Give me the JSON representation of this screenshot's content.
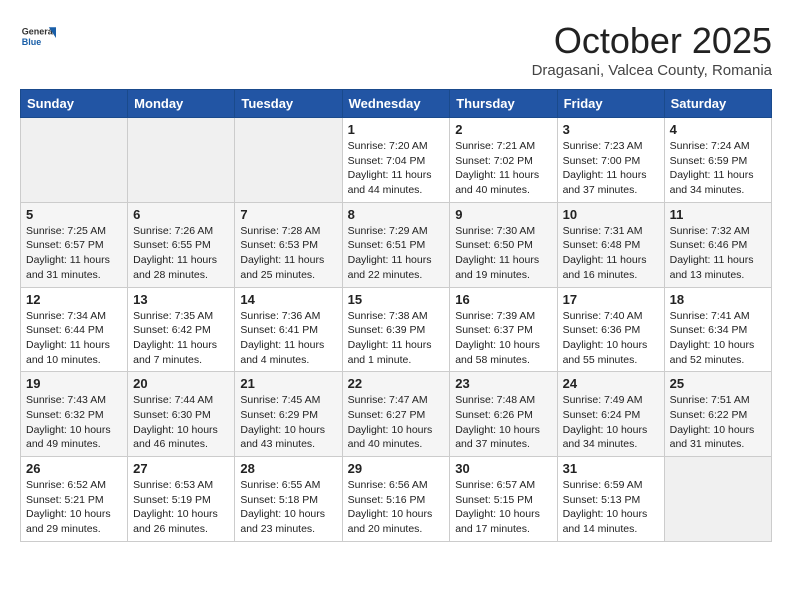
{
  "header": {
    "logo_general": "General",
    "logo_blue": "Blue",
    "month": "October 2025",
    "location": "Dragasani, Valcea County, Romania"
  },
  "weekdays": [
    "Sunday",
    "Monday",
    "Tuesday",
    "Wednesday",
    "Thursday",
    "Friday",
    "Saturday"
  ],
  "weeks": [
    [
      {
        "day": "",
        "info": ""
      },
      {
        "day": "",
        "info": ""
      },
      {
        "day": "",
        "info": ""
      },
      {
        "day": "1",
        "info": "Sunrise: 7:20 AM\nSunset: 7:04 PM\nDaylight: 11 hours and 44 minutes."
      },
      {
        "day": "2",
        "info": "Sunrise: 7:21 AM\nSunset: 7:02 PM\nDaylight: 11 hours and 40 minutes."
      },
      {
        "day": "3",
        "info": "Sunrise: 7:23 AM\nSunset: 7:00 PM\nDaylight: 11 hours and 37 minutes."
      },
      {
        "day": "4",
        "info": "Sunrise: 7:24 AM\nSunset: 6:59 PM\nDaylight: 11 hours and 34 minutes."
      }
    ],
    [
      {
        "day": "5",
        "info": "Sunrise: 7:25 AM\nSunset: 6:57 PM\nDaylight: 11 hours and 31 minutes."
      },
      {
        "day": "6",
        "info": "Sunrise: 7:26 AM\nSunset: 6:55 PM\nDaylight: 11 hours and 28 minutes."
      },
      {
        "day": "7",
        "info": "Sunrise: 7:28 AM\nSunset: 6:53 PM\nDaylight: 11 hours and 25 minutes."
      },
      {
        "day": "8",
        "info": "Sunrise: 7:29 AM\nSunset: 6:51 PM\nDaylight: 11 hours and 22 minutes."
      },
      {
        "day": "9",
        "info": "Sunrise: 7:30 AM\nSunset: 6:50 PM\nDaylight: 11 hours and 19 minutes."
      },
      {
        "day": "10",
        "info": "Sunrise: 7:31 AM\nSunset: 6:48 PM\nDaylight: 11 hours and 16 minutes."
      },
      {
        "day": "11",
        "info": "Sunrise: 7:32 AM\nSunset: 6:46 PM\nDaylight: 11 hours and 13 minutes."
      }
    ],
    [
      {
        "day": "12",
        "info": "Sunrise: 7:34 AM\nSunset: 6:44 PM\nDaylight: 11 hours and 10 minutes."
      },
      {
        "day": "13",
        "info": "Sunrise: 7:35 AM\nSunset: 6:42 PM\nDaylight: 11 hours and 7 minutes."
      },
      {
        "day": "14",
        "info": "Sunrise: 7:36 AM\nSunset: 6:41 PM\nDaylight: 11 hours and 4 minutes."
      },
      {
        "day": "15",
        "info": "Sunrise: 7:38 AM\nSunset: 6:39 PM\nDaylight: 11 hours and 1 minute."
      },
      {
        "day": "16",
        "info": "Sunrise: 7:39 AM\nSunset: 6:37 PM\nDaylight: 10 hours and 58 minutes."
      },
      {
        "day": "17",
        "info": "Sunrise: 7:40 AM\nSunset: 6:36 PM\nDaylight: 10 hours and 55 minutes."
      },
      {
        "day": "18",
        "info": "Sunrise: 7:41 AM\nSunset: 6:34 PM\nDaylight: 10 hours and 52 minutes."
      }
    ],
    [
      {
        "day": "19",
        "info": "Sunrise: 7:43 AM\nSunset: 6:32 PM\nDaylight: 10 hours and 49 minutes."
      },
      {
        "day": "20",
        "info": "Sunrise: 7:44 AM\nSunset: 6:30 PM\nDaylight: 10 hours and 46 minutes."
      },
      {
        "day": "21",
        "info": "Sunrise: 7:45 AM\nSunset: 6:29 PM\nDaylight: 10 hours and 43 minutes."
      },
      {
        "day": "22",
        "info": "Sunrise: 7:47 AM\nSunset: 6:27 PM\nDaylight: 10 hours and 40 minutes."
      },
      {
        "day": "23",
        "info": "Sunrise: 7:48 AM\nSunset: 6:26 PM\nDaylight: 10 hours and 37 minutes."
      },
      {
        "day": "24",
        "info": "Sunrise: 7:49 AM\nSunset: 6:24 PM\nDaylight: 10 hours and 34 minutes."
      },
      {
        "day": "25",
        "info": "Sunrise: 7:51 AM\nSunset: 6:22 PM\nDaylight: 10 hours and 31 minutes."
      }
    ],
    [
      {
        "day": "26",
        "info": "Sunrise: 6:52 AM\nSunset: 5:21 PM\nDaylight: 10 hours and 29 minutes."
      },
      {
        "day": "27",
        "info": "Sunrise: 6:53 AM\nSunset: 5:19 PM\nDaylight: 10 hours and 26 minutes."
      },
      {
        "day": "28",
        "info": "Sunrise: 6:55 AM\nSunset: 5:18 PM\nDaylight: 10 hours and 23 minutes."
      },
      {
        "day": "29",
        "info": "Sunrise: 6:56 AM\nSunset: 5:16 PM\nDaylight: 10 hours and 20 minutes."
      },
      {
        "day": "30",
        "info": "Sunrise: 6:57 AM\nSunset: 5:15 PM\nDaylight: 10 hours and 17 minutes."
      },
      {
        "day": "31",
        "info": "Sunrise: 6:59 AM\nSunset: 5:13 PM\nDaylight: 10 hours and 14 minutes."
      },
      {
        "day": "",
        "info": ""
      }
    ]
  ]
}
